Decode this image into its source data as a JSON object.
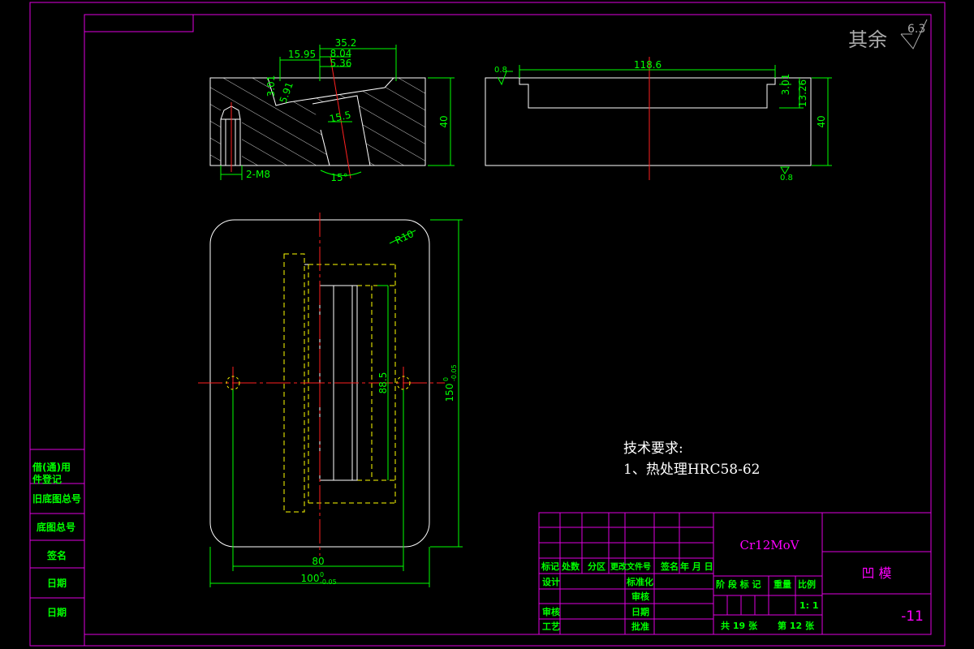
{
  "colors": {
    "frame": "#e000e0",
    "outline": "#ffffff",
    "dimension": "#00ff00",
    "centerline": "#ff2020",
    "hidden": "#ffff00",
    "text_green": "#00ff00",
    "text_magenta": "#ff00ff",
    "text_white": "#ffffff",
    "text_gray": "#aaaaaa"
  },
  "surface_finish": {
    "label": "其余",
    "value": "6.3"
  },
  "views": {
    "front": {
      "dims": {
        "d35_2": "35.2",
        "d15_95": "15.95",
        "d8_04": "8.04",
        "d5_36": "5.36",
        "d3_01": "3.01",
        "d3_01b": "3.01",
        "d5_91": "5.91",
        "d15_5": "15.5",
        "d40": "40",
        "thread": "2-M8",
        "angle": "15°"
      }
    },
    "side": {
      "dims": {
        "d118_6": "118.6",
        "d3_01": "3.01",
        "d13_26": "13.26",
        "d40": "40",
        "rough_top": "0.8",
        "rough_bottom": "0.8"
      }
    },
    "top": {
      "dims": {
        "r10": "R10",
        "d88_5": "88.5",
        "d150": "150",
        "d150_tol": "0",
        "d150_tol2": "-0.05",
        "d80": "80",
        "d100": "100",
        "d100_tol": "0",
        "d100_tol2": "-0.05"
      }
    }
  },
  "tech_requirements": {
    "heading": "技术要求:",
    "item1": "1、热处理HRC58-62"
  },
  "side_table": {
    "r1a": "借(通)用",
    "r1b": "件登记",
    "r2": "旧底图总号",
    "r3": "底图总号",
    "r4": "签名",
    "r5": "日期",
    "r6": "日期"
  },
  "title_block": {
    "material": "Cr12MoV",
    "part_name": "凹  模",
    "drawing_no": "-11",
    "header": [
      "标记",
      "处数",
      "分区",
      "更改文件号",
      "签名",
      "年 月 日"
    ],
    "design": "设计",
    "standardize": "标准化",
    "review": "审核",
    "process": "工艺",
    "approve": "批准",
    "check": "审核",
    "date_label": "日期",
    "stage_header": [
      "阶 段 标 记",
      "重量",
      "比例"
    ],
    "scale": "1: 1",
    "total": "共  19 张",
    "sheet": "第 12 张"
  }
}
